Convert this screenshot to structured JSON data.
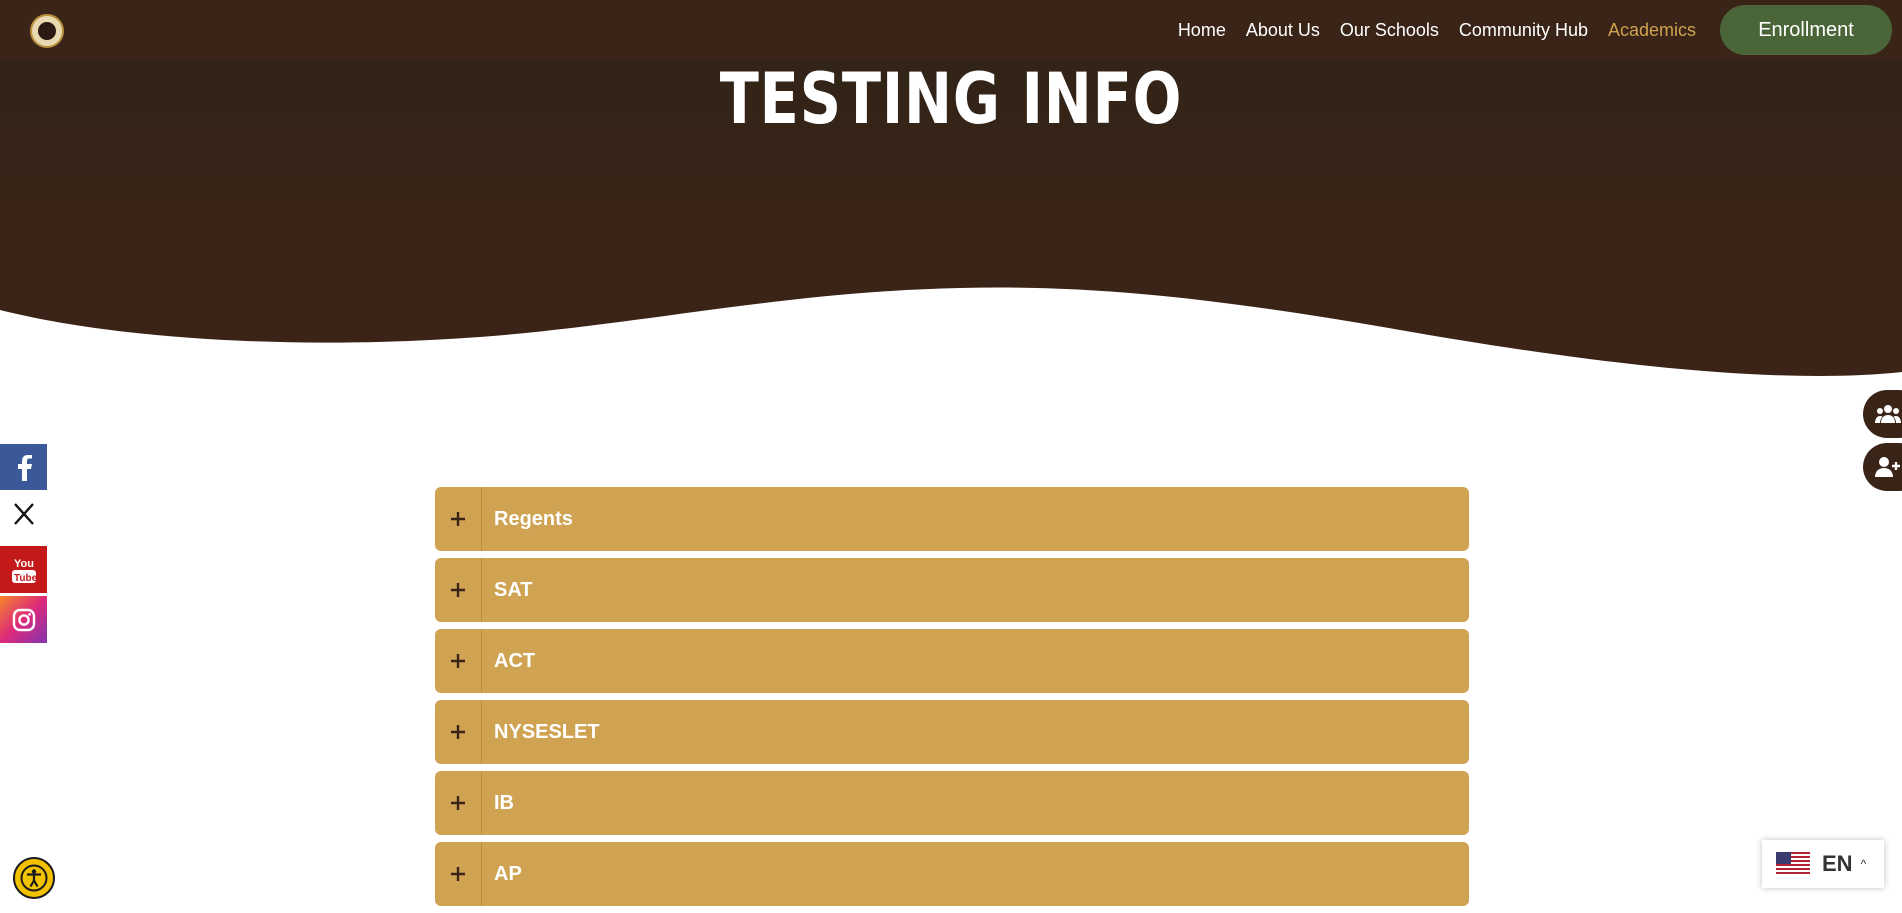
{
  "nav": {
    "logo_name": "school-seal-logo",
    "links": [
      "Home",
      "About Us",
      "Our Schools",
      "Community Hub",
      "Academics"
    ],
    "active": "Academics",
    "enroll_label": "Enrollment"
  },
  "hero": {
    "title": "TESTING INFO"
  },
  "social": [
    "facebook-icon",
    "x-icon",
    "youtube-icon",
    "instagram-icon"
  ],
  "floating_buttons": [
    "community-icon",
    "add-user-icon"
  ],
  "accordion": {
    "items": [
      {
        "title": "Regents",
        "toggle": "+"
      },
      {
        "title": "SAT",
        "toggle": "+"
      },
      {
        "title": "ACT",
        "toggle": "+"
      },
      {
        "title": "NYSESLET",
        "toggle": "+"
      },
      {
        "title": "IB",
        "toggle": "+"
      },
      {
        "title": "AP",
        "toggle": "+"
      }
    ]
  },
  "language": {
    "code": "EN",
    "flag": "us-flag-icon"
  },
  "colors": {
    "brand_dark": "#3a2317",
    "accent_gold": "#cfa352",
    "enroll_green": "#4a6638"
  }
}
